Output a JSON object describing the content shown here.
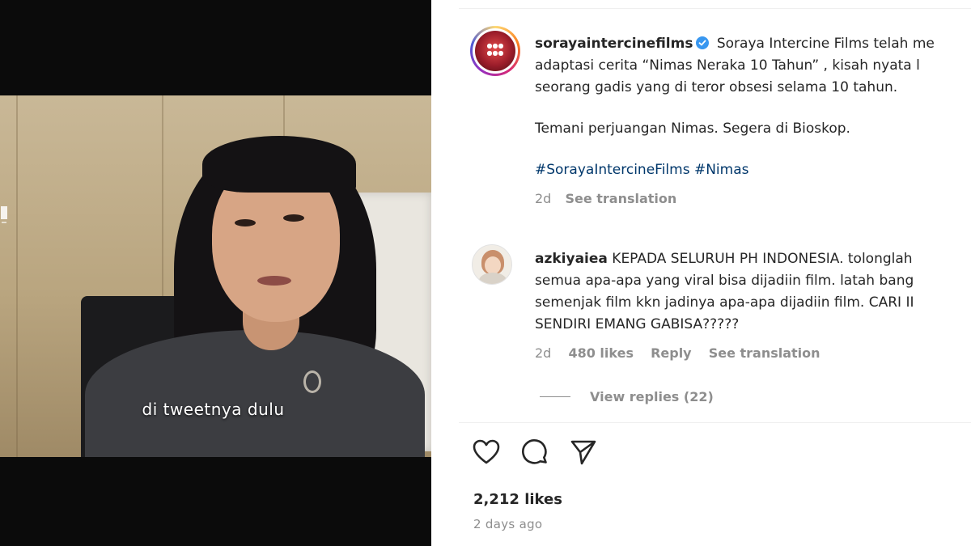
{
  "video": {
    "subtitle": "di  tweetnya dulu"
  },
  "post": {
    "username": "sorayaintercinefilms",
    "verified": true,
    "caption_lines": [
      "Soraya Intercine Films telah me",
      "adaptasi cerita “Nimas Neraka 10 Tahun” , kisah nyata l",
      "seorang gadis yang di teror obsesi selama 10 tahun."
    ],
    "caption_line2": "Temani perjuangan Nimas. Segera di Bioskop.",
    "hashtags": "#SorayaIntercineFilms #Nimas",
    "time": "2d",
    "see_translation": "See translation"
  },
  "comment": {
    "username": "azkiyaiea",
    "lines": [
      "KEPADA SELURUH PH INDONESIA. tolonglah",
      "semua apa-apa yang viral bisa dijadiin film. latah bang",
      "semenjak film kkn jadinya apa-apa dijadiin film. CARI II",
      "SENDIRI EMANG GABISA?????"
    ],
    "time": "2d",
    "likes": "480 likes",
    "reply": "Reply",
    "see_translation": "See translation",
    "view_replies": "View replies (22)"
  },
  "actions": {
    "like_icon": "heart-icon",
    "comment_icon": "comment-icon",
    "share_icon": "share-icon"
  },
  "stats": {
    "likes": "2,212 likes",
    "posted": "2 days ago"
  },
  "colors": {
    "verified": "#3897f0",
    "hashtag": "#00376b",
    "secondary_text": "#8e8e8e",
    "video_bg": "#0b0b0b"
  }
}
